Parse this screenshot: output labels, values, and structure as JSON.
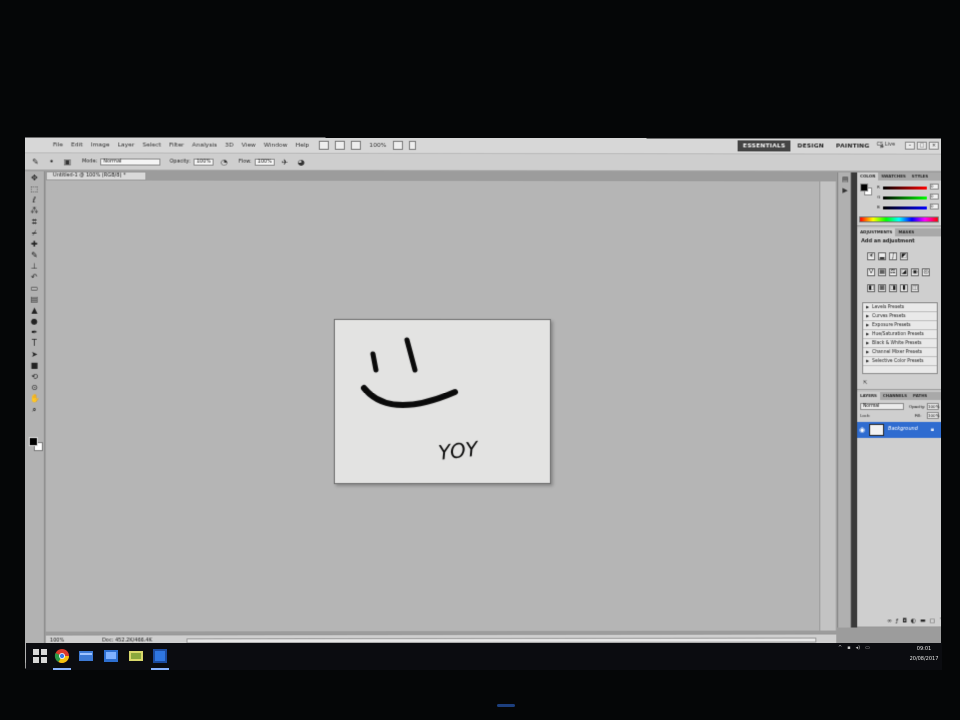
{
  "menu": [
    "File",
    "Edit",
    "Image",
    "Layer",
    "Select",
    "Filter",
    "Analysis",
    "3D",
    "View",
    "Window",
    "Help"
  ],
  "appbar": {
    "zoom": "100%"
  },
  "workspaces": {
    "items": [
      "ESSENTIALS",
      "DESIGN",
      "PAINTING"
    ],
    "more": "»"
  },
  "cs_live": "CS Live",
  "options_bar": {
    "mode_label": "Mode:",
    "mode_value": "Normal",
    "opacity_label": "Opacity:",
    "opacity_value": "100%",
    "flow_label": "Flow:",
    "flow_value": "100%"
  },
  "document": {
    "tab_title": "Untitled-1 @ 100% (RGB/8) *",
    "canvas_text": "YOY",
    "zoom": "100%",
    "doc_size": "Doc: 452.2K/466.4K"
  },
  "color_panel": {
    "tabs": [
      "COLOR",
      "SWATCHES",
      "STYLES"
    ],
    "channels": [
      {
        "name": "R",
        "value": "0"
      },
      {
        "name": "G",
        "value": "0"
      },
      {
        "name": "B",
        "value": "0"
      }
    ]
  },
  "adjustments_panel": {
    "tabs": [
      "ADJUSTMENTS",
      "MASKS"
    ],
    "title": "Add an adjustment",
    "presets": [
      "Levels Presets",
      "Curves Presets",
      "Exposure Presets",
      "Hue/Saturation Presets",
      "Black & White Presets",
      "Channel Mixer Presets",
      "Selective Color Presets"
    ]
  },
  "layers_panel": {
    "tabs": [
      "LAYERS",
      "CHANNELS",
      "PATHS"
    ],
    "blend_mode": "Normal",
    "opacity_label": "Opacity:",
    "opacity_value": "100%",
    "lock_label": "Lock:",
    "fill_label": "Fill:",
    "fill_value": "100%",
    "layer_name": "Background"
  },
  "taskbar": {
    "icons": [
      "windows-start-icon",
      "chrome-icon",
      "file-explorer-icon",
      "store-icon",
      "photos-icon",
      "folder-icon",
      "photoshop-icon"
    ],
    "time": "09:01",
    "date": "20/08/2017"
  },
  "colors": {
    "selected_layer": "#2f6cd0",
    "workspace_active": "#444444"
  }
}
